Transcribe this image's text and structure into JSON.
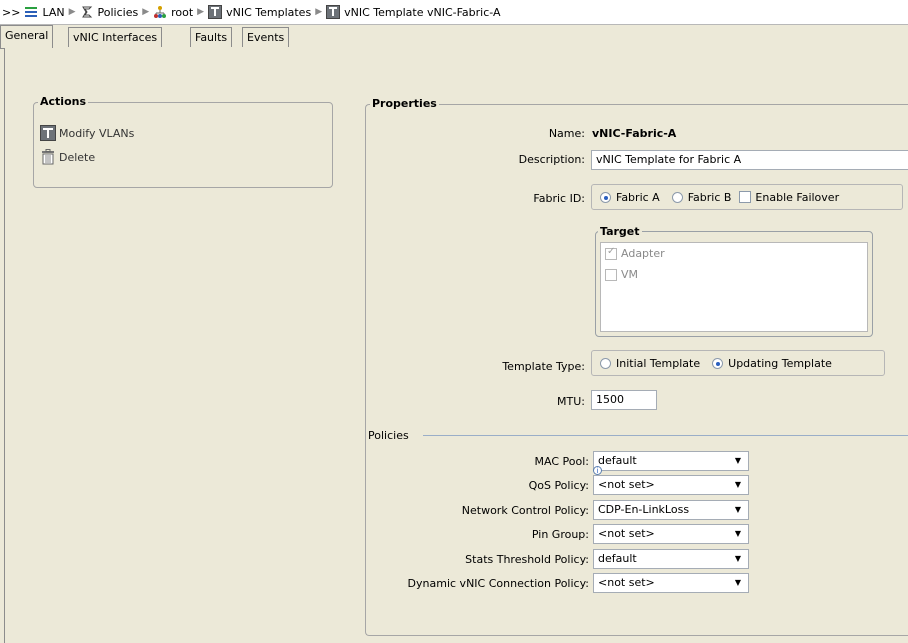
{
  "breadcrumb": {
    "prefix": ">>",
    "items": [
      {
        "label": "LAN",
        "icon": "lan-icon"
      },
      {
        "label": "Policies",
        "icon": "policies-icon"
      },
      {
        "label": "root",
        "icon": "org-tree-icon"
      },
      {
        "label": "vNIC Templates",
        "icon": "template-icon"
      },
      {
        "label": "vNIC Template vNIC-Fabric-A",
        "icon": "template-icon"
      }
    ]
  },
  "tabs": [
    {
      "label": "General",
      "active": true
    },
    {
      "label": "vNIC Interfaces",
      "active": false
    },
    {
      "label": "Faults",
      "active": false
    },
    {
      "label": "Events",
      "active": false
    }
  ],
  "actions": {
    "title": "Actions",
    "items": [
      {
        "label": "Modify VLANs",
        "icon": "template-icon"
      },
      {
        "label": "Delete",
        "icon": "trash-icon"
      }
    ]
  },
  "properties": {
    "title": "Properties",
    "name_label": "Name:",
    "name_value": "vNIC-Fabric-A",
    "description_label": "Description:",
    "description_value": "vNIC Template for Fabric A",
    "fabric_label": "Fabric ID:",
    "fabric_a": "Fabric A",
    "fabric_b": "Fabric B",
    "enable_failover": "Enable Failover",
    "fabric_selected": "Fabric A",
    "target_title": "Target",
    "target_adapter": "Adapter",
    "target_vm": "VM",
    "template_type_label": "Template Type:",
    "initial_template": "Initial Template",
    "updating_template": "Updating Template",
    "template_type_selected": "Updating Template",
    "mtu_label": "MTU:",
    "mtu_value": "1500"
  },
  "policies": {
    "title": "Policies",
    "rows": [
      {
        "label": "MAC Pool:",
        "value": "default"
      },
      {
        "label": "QoS Policy:",
        "value": "<not set>"
      },
      {
        "label": "Network Control Policy:",
        "value": "CDP-En-LinkLoss"
      },
      {
        "label": "Pin Group:",
        "value": "<not set>"
      },
      {
        "label": "Stats Threshold Policy:",
        "value": "default"
      },
      {
        "label": "Dynamic vNIC Connection Policy:",
        "value": "<not set>"
      }
    ]
  },
  "colors": {
    "background": "#ece9d8",
    "radio_dot": "#2a5fbf",
    "lan_icon": "#2aa040",
    "org_icon": "#d4a000"
  }
}
